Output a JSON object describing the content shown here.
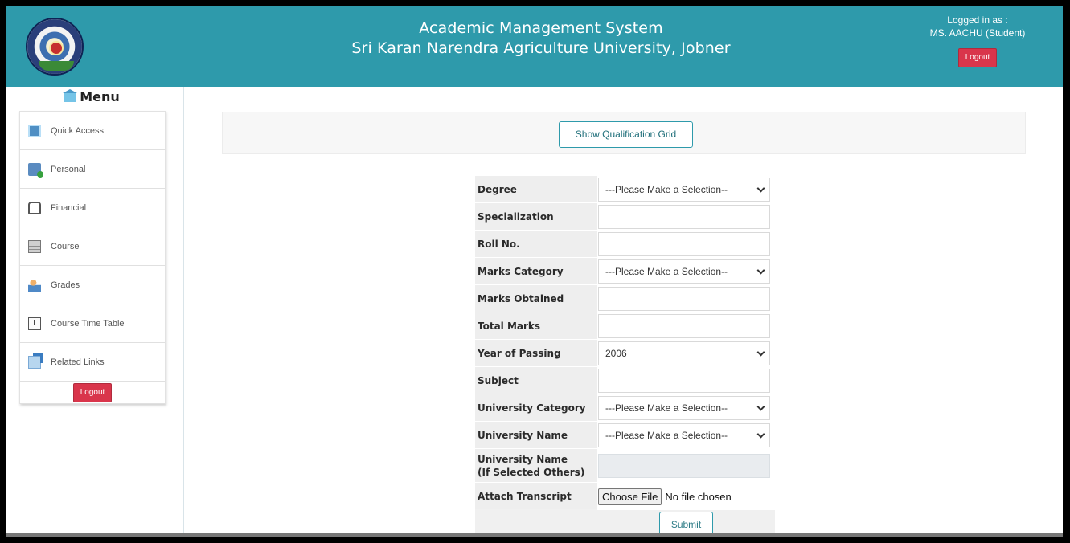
{
  "header": {
    "title": "Academic Management System",
    "subtitle": "Sri Karan Narendra Agriculture University, Jobner",
    "login_label": "Logged in as :",
    "user": "MS. AACHU (Student)",
    "logout": "Logout"
  },
  "sidebar": {
    "menu_title": "Menu",
    "items": [
      {
        "label": "Quick Access",
        "icon": "quick-access-icon"
      },
      {
        "label": "Personal",
        "icon": "personal-icon"
      },
      {
        "label": "Financial",
        "icon": "financial-icon"
      },
      {
        "label": "Course",
        "icon": "course-icon"
      },
      {
        "label": "Grades",
        "icon": "grades-icon"
      },
      {
        "label": "Course Time Table",
        "icon": "course-time-table-icon"
      },
      {
        "label": "Related Links",
        "icon": "related-links-icon"
      }
    ],
    "logout": "Logout"
  },
  "main": {
    "qualification_button": "Show Qualification Grid"
  },
  "form": {
    "rows": [
      {
        "label": "Degree",
        "type": "select",
        "value": "---Please Make a Selection--"
      },
      {
        "label": "Specialization",
        "type": "input",
        "value": ""
      },
      {
        "label": "Roll No.",
        "type": "input",
        "value": ""
      },
      {
        "label": "Marks Category",
        "type": "select",
        "value": "---Please Make a Selection--"
      },
      {
        "label": "Marks Obtained",
        "type": "input",
        "value": ""
      },
      {
        "label": "Total Marks",
        "type": "input",
        "value": ""
      },
      {
        "label": "Year of Passing",
        "type": "select",
        "value": "2006"
      },
      {
        "label": "Subject",
        "type": "input",
        "value": ""
      },
      {
        "label": "University Category",
        "type": "select",
        "value": "---Please Make a Selection--"
      },
      {
        "label": "University Name",
        "type": "select",
        "value": "---Please Make a Selection--"
      },
      {
        "label": "University Name",
        "label2": "(If Selected Others)",
        "type": "disabled",
        "value": ""
      },
      {
        "label": "Attach Transcript",
        "type": "file",
        "button": "Choose File",
        "status": "No file chosen"
      }
    ],
    "submit": "Submit"
  }
}
